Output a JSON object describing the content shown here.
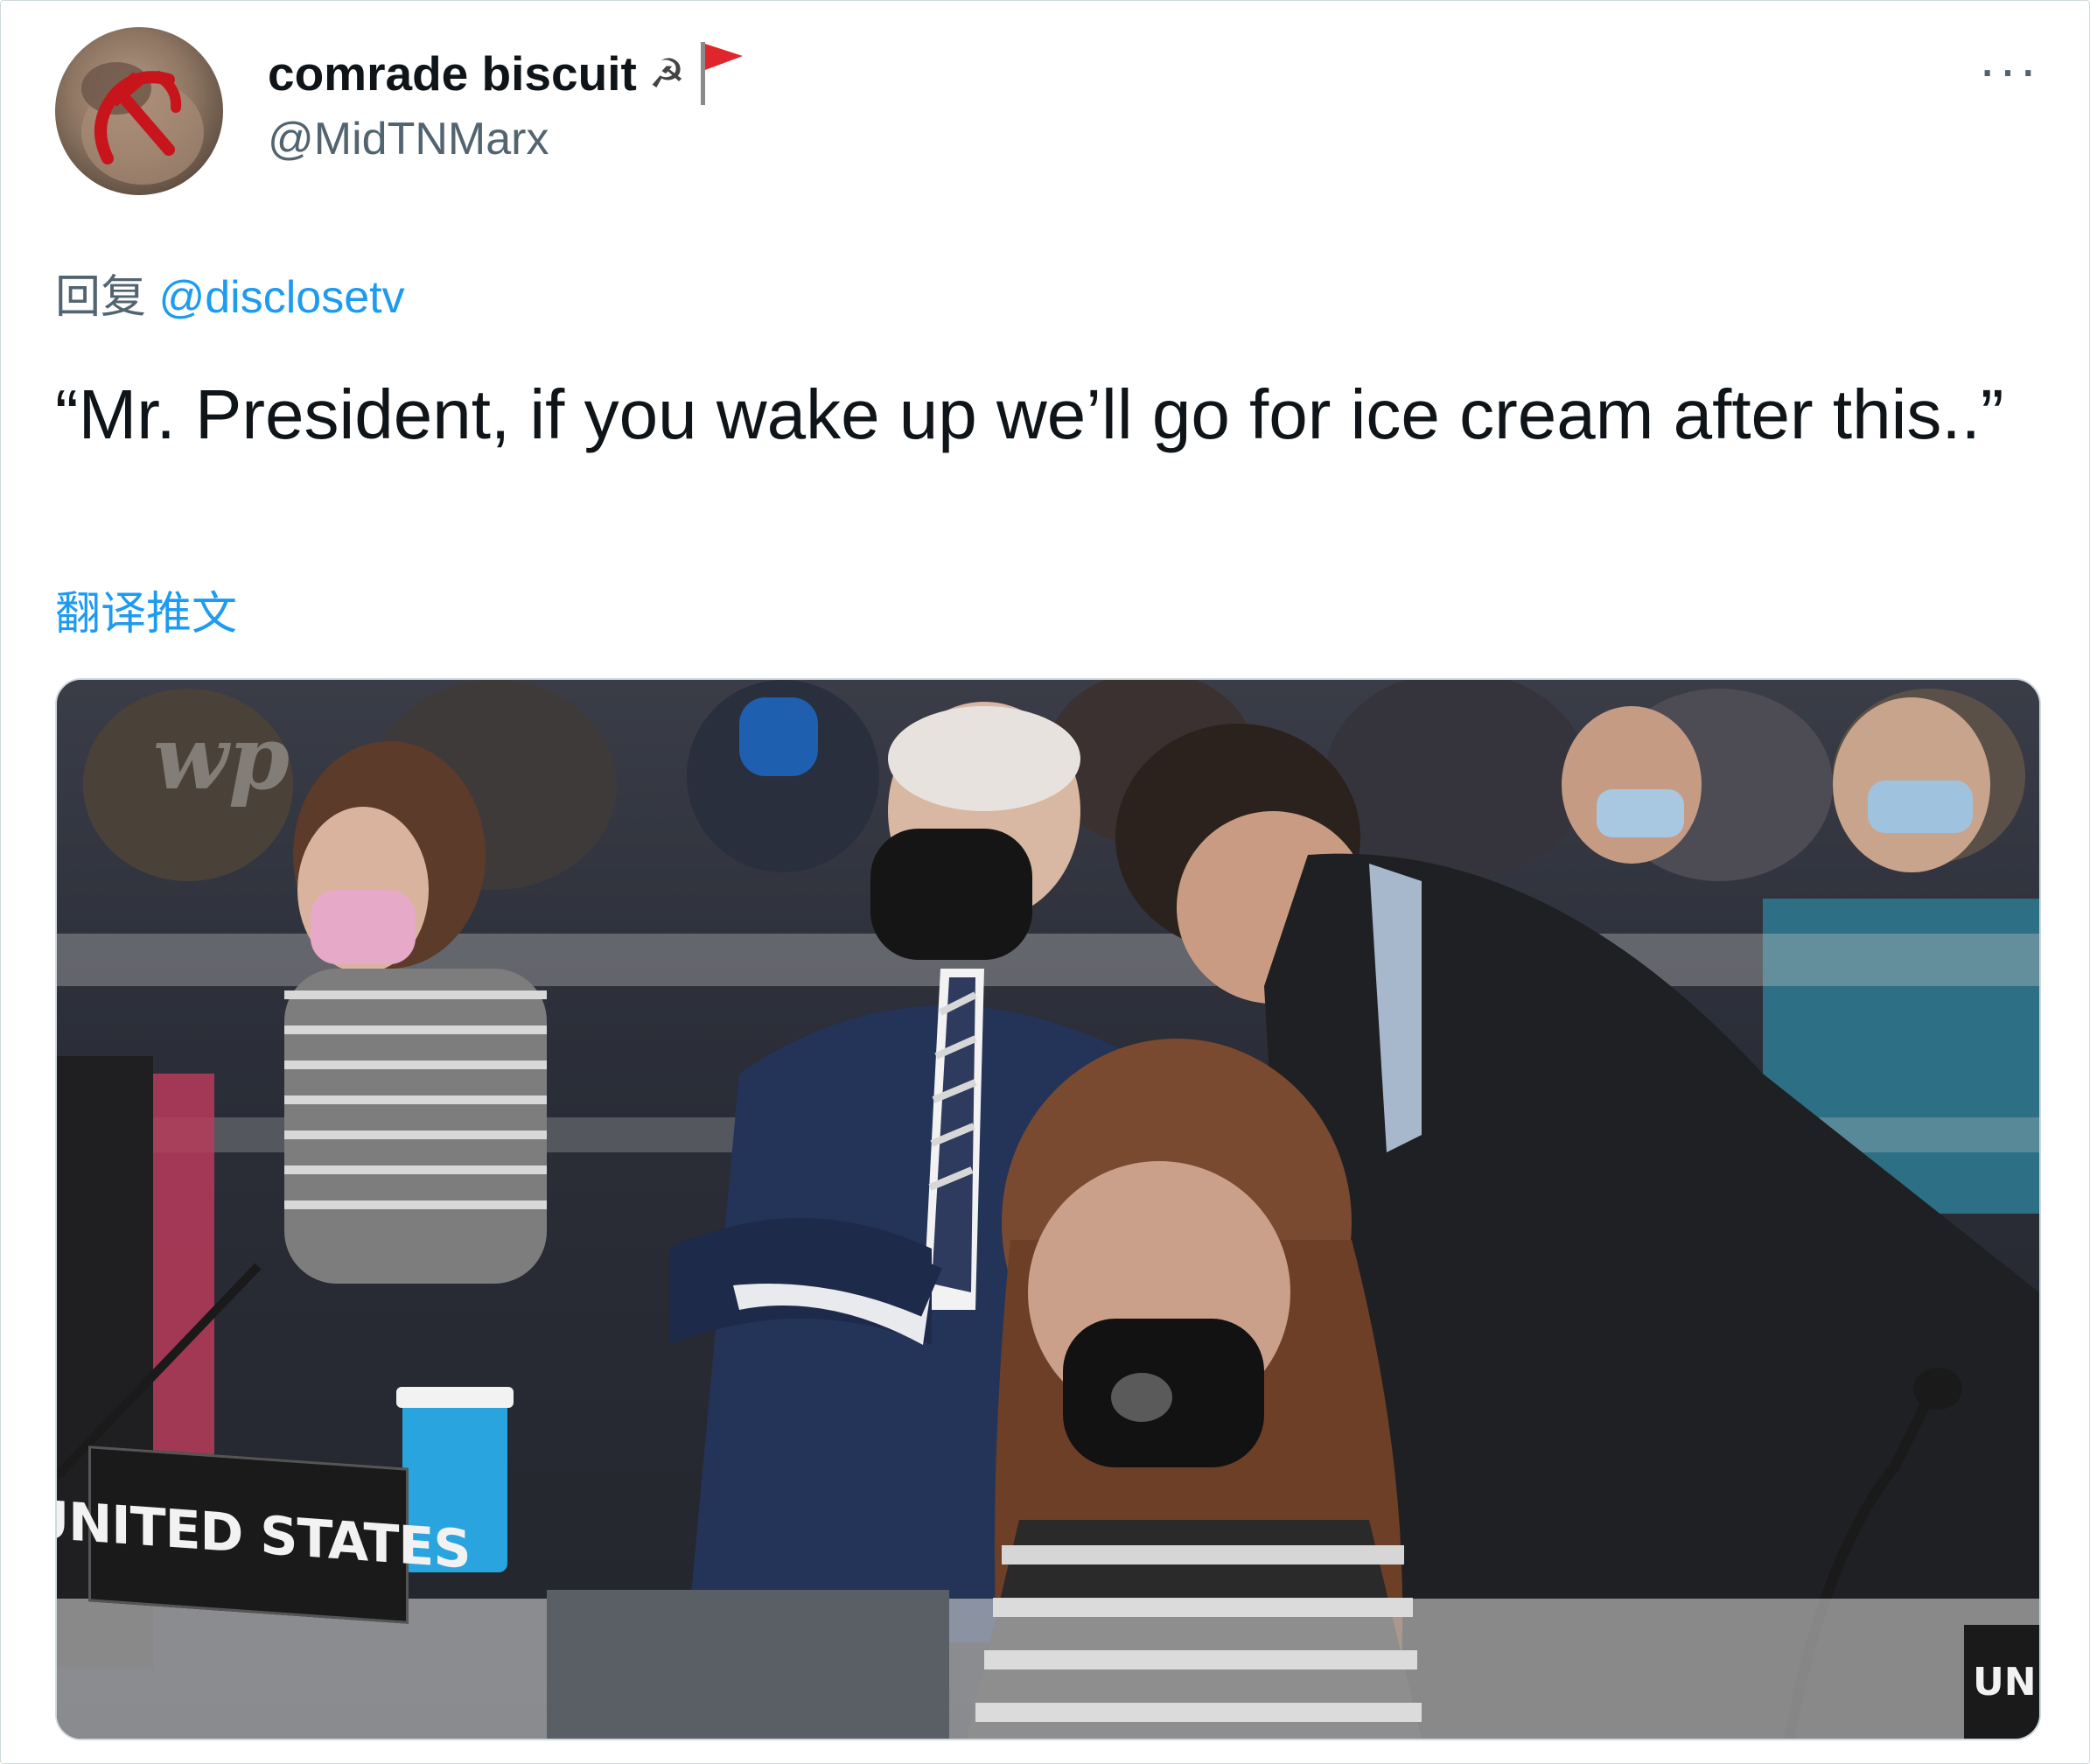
{
  "author": {
    "display_name": "comrade biscuit",
    "handle": "@MidTNMarx",
    "avatar_icon": "hammer-and-sickle-icon",
    "name_emojis": [
      "sickle-icon",
      "red-flag-icon"
    ]
  },
  "more_label": "···",
  "reply": {
    "prefix": "回复",
    "mention": "@disclosetv"
  },
  "tweet": {
    "text": "“Mr. President, if you wake up we’ll go for ice cream after this..”"
  },
  "translate_label": "翻译推文",
  "media": {
    "watermark": "wp",
    "nameplate_text": "UNITED STATES",
    "nameplate_right_text": "UNI"
  },
  "colors": {
    "link": "#1d9bf0",
    "secondary_text": "#536471",
    "primary_text": "#0f1419",
    "flag": "#e0262d"
  }
}
